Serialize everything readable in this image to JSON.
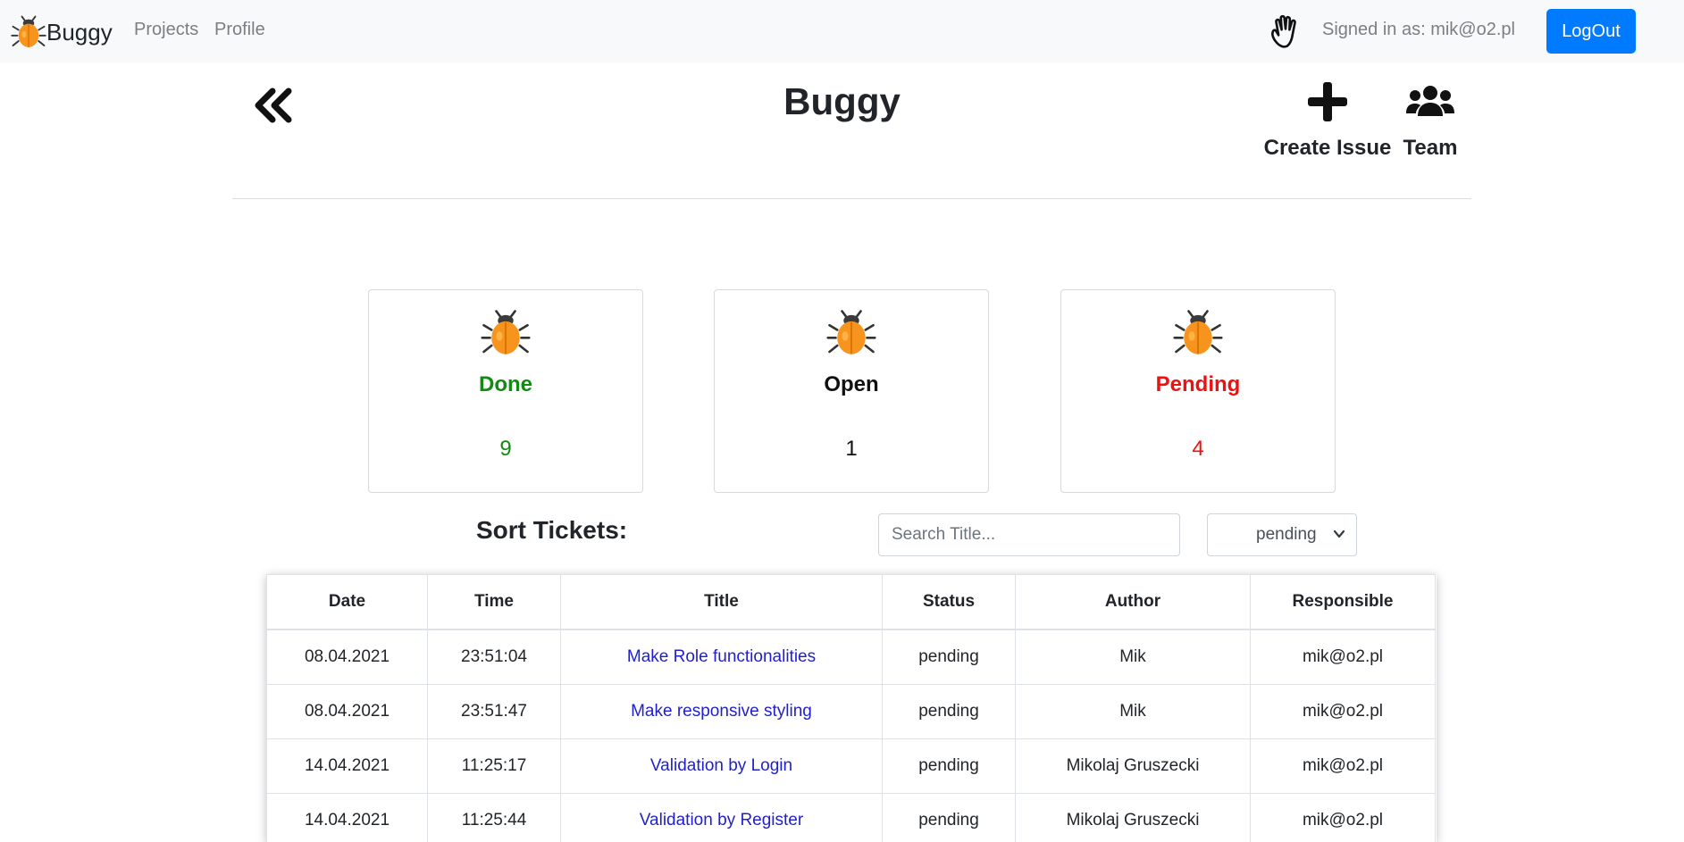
{
  "navbar": {
    "brand": "Buggy",
    "links": [
      "Projects",
      "Profile"
    ],
    "signed_in": "Signed in as: mik@o2.pl",
    "logout_label": "LogOut"
  },
  "header": {
    "title": "Buggy",
    "create_label": "Create Issue",
    "team_label": "Team"
  },
  "stats": [
    {
      "label": "Done",
      "count": "9",
      "color": "#138a13"
    },
    {
      "label": "Open",
      "count": "1",
      "color": "#111111"
    },
    {
      "label": "Pending",
      "count": "4",
      "color": "#ee1111"
    }
  ],
  "sort": {
    "heading": "Sort Tickets:",
    "search_placeholder": "Search Title...",
    "status_selected": "pending"
  },
  "table": {
    "columns": [
      "Date",
      "Time",
      "Title",
      "Status",
      "Author",
      "Responsible"
    ],
    "rows": [
      [
        "08.04.2021",
        "23:51:04",
        "Make Role functionalities",
        "pending",
        "Mik",
        "mik@o2.pl"
      ],
      [
        "08.04.2021",
        "23:51:47",
        "Make responsive styling",
        "pending",
        "Mik",
        "mik@o2.pl"
      ],
      [
        "14.04.2021",
        "11:25:17",
        "Validation by Login",
        "pending",
        "Mikolaj Gruszecki",
        "mik@o2.pl"
      ],
      [
        "14.04.2021",
        "11:25:44",
        "Validation by Register",
        "pending",
        "Mikolaj Gruszecki",
        "mik@o2.pl"
      ]
    ]
  },
  "icons": {
    "brand": "bug-icon",
    "navbar_right": "hand-wave-icon",
    "back": "double-chevron-left-icon",
    "create": "plus-icon",
    "team": "users-icon",
    "cards": "bug-icon",
    "select": "chevron-down-icon"
  },
  "colors": {
    "accent": "#007bff",
    "link": "#1f1fcf",
    "navbar_bg": "#f8f9fa"
  }
}
